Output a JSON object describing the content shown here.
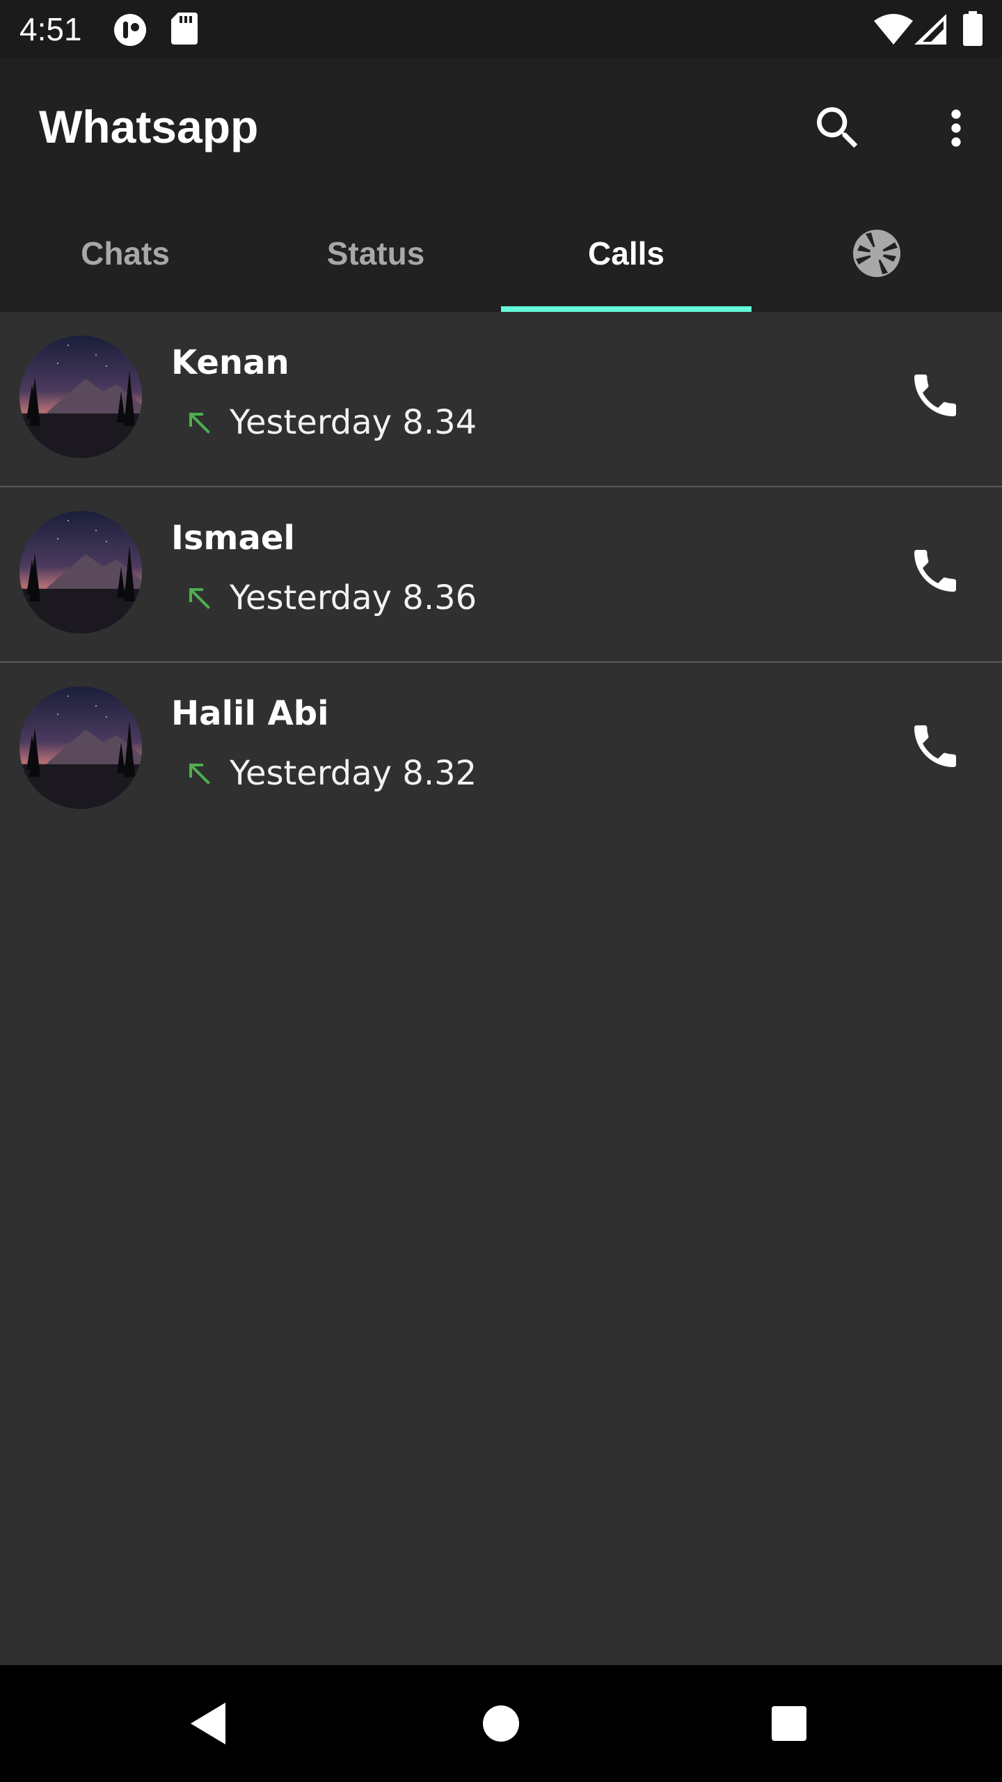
{
  "status_bar": {
    "time": "4:51",
    "icons": [
      "notification-app-icon",
      "sd-card-icon",
      "wifi-icon",
      "signal-icon",
      "battery-icon"
    ]
  },
  "app_bar": {
    "title": "Whatsapp",
    "actions": [
      "search-icon",
      "more-vert-icon"
    ]
  },
  "tabs": [
    {
      "label": "Chats",
      "active": false
    },
    {
      "label": "Status",
      "active": false
    },
    {
      "label": "Calls",
      "active": true
    },
    {
      "icon": "camera-icon",
      "active": false
    }
  ],
  "calls": [
    {
      "name": "Kenan",
      "time": "Yesterday 8.34",
      "direction_icon": "call-made-icon",
      "action_icon": "phone-icon"
    },
    {
      "name": "Ismael",
      "time": "Yesterday 8.36",
      "direction_icon": "call-made-icon",
      "action_icon": "phone-icon"
    },
    {
      "name": "Halil Abi",
      "time": "Yesterday 8.32",
      "direction_icon": "call-made-icon",
      "action_icon": "phone-icon"
    }
  ],
  "nav_bar": [
    "back-icon",
    "home-icon",
    "recents-icon"
  ],
  "colors": {
    "background": "#303030",
    "app_bar": "#212121",
    "status_bar": "#1b1b1b",
    "tab_indicator": "#64ffda",
    "call_arrow": "#4caf50",
    "divider": "#5a5a5a"
  }
}
